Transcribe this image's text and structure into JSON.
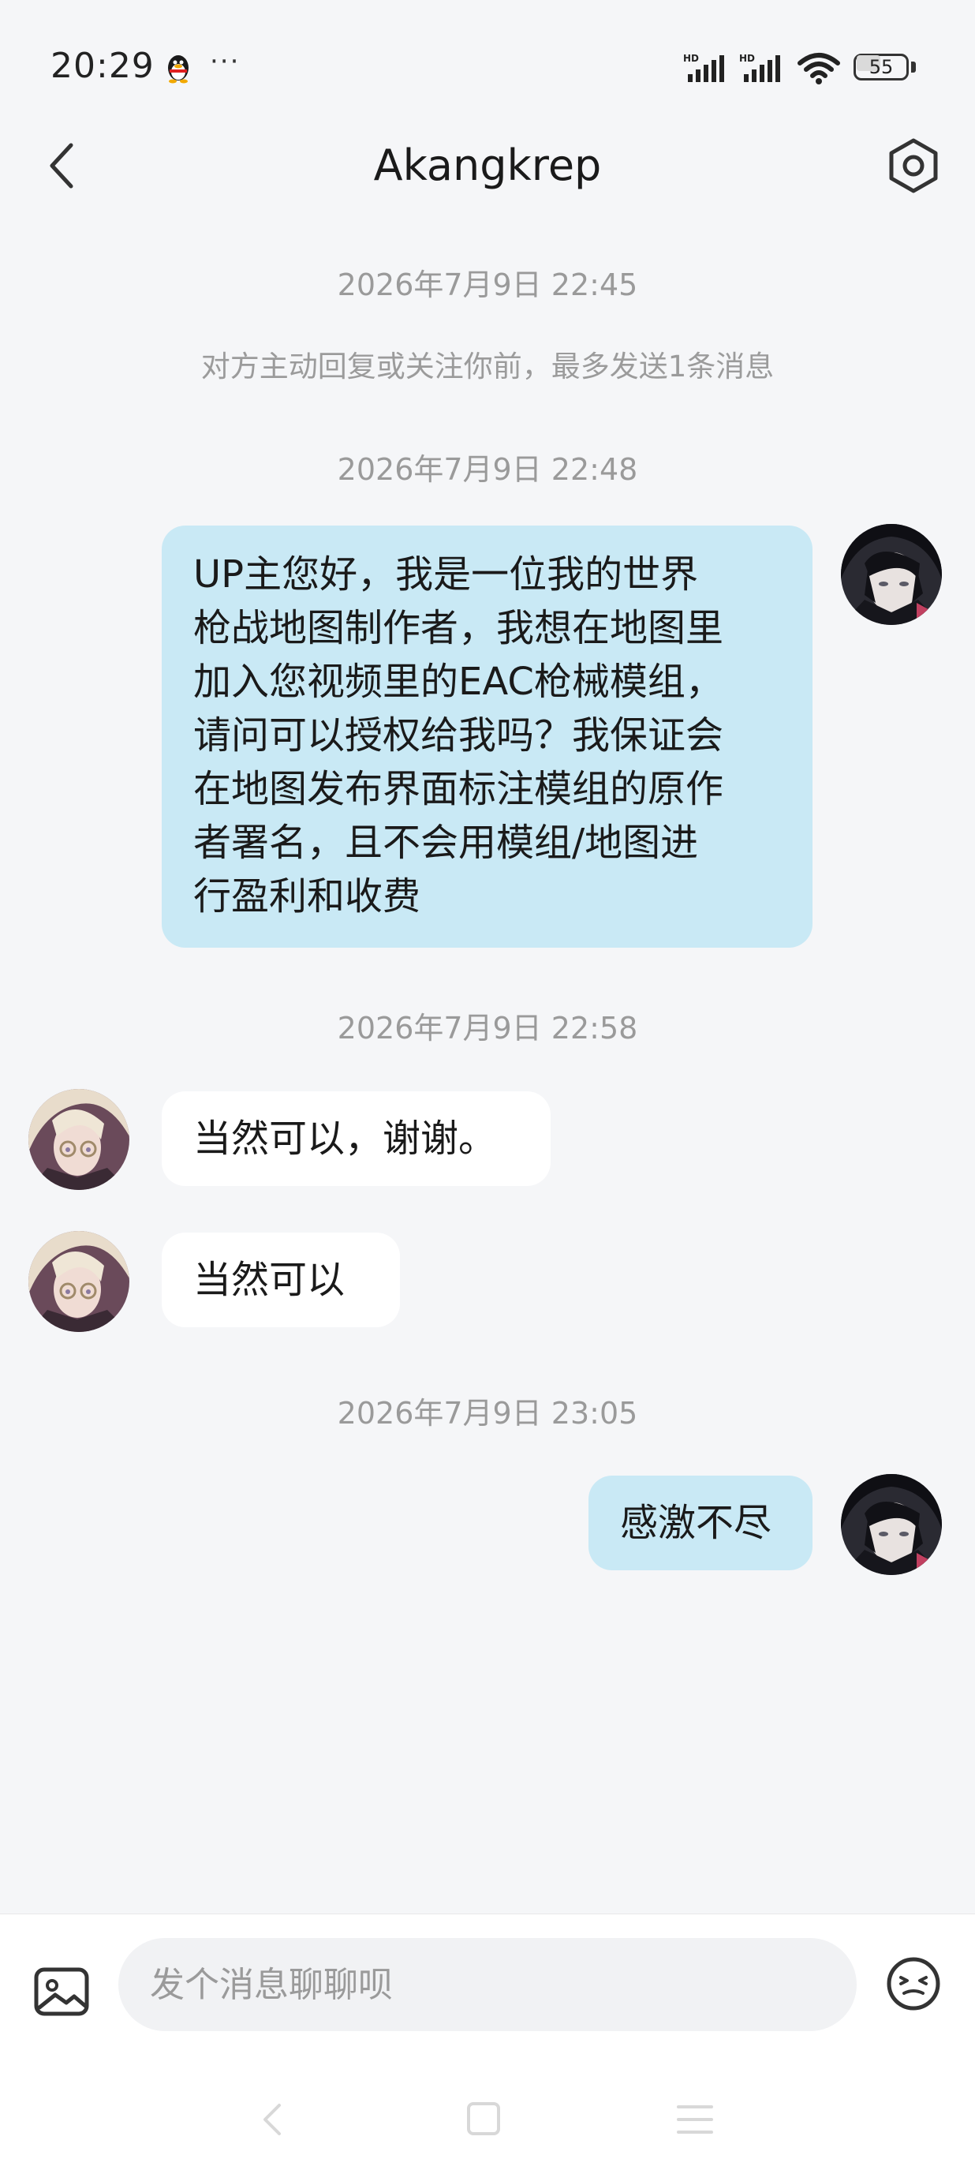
{
  "status_bar": {
    "time": "20:29",
    "battery": "55",
    "icons": [
      "qq-penguin-icon",
      "more-dots-icon",
      "hd-signal-icon",
      "hd-signal-icon",
      "wifi-icon",
      "battery-icon"
    ],
    "more": "···"
  },
  "header": {
    "title": "Akangkrep",
    "back_icon": "chevron-left-icon",
    "settings_icon": "hexagon-settings-icon"
  },
  "chat": {
    "timestamp_1": "2026年7月9日 22:45",
    "notice": "对方主动回复或关注你前，最多发送1条消息",
    "timestamp_2": "2026年7月9日 22:48",
    "msg_1": "UP主您好，我是一位我的世界\n枪战地图制作者，我想在地图里\n加入您视频里的EAC枪械模组，\n请问可以授权给我吗？我保证会\n在地图发布界面标注模组的原作\n者署名，且不会用模组/地图进\n行盈利和收费",
    "timestamp_3": "2026年7月9日 22:58",
    "reply_1": "当然可以，谢谢。",
    "reply_2": "当然可以",
    "timestamp_4": "2026年7月9日 23:05",
    "msg_2": "感激不尽"
  },
  "input_bar": {
    "placeholder": "发个消息聊聊呗",
    "image_icon": "image-icon",
    "emoji_icon": "emoji-icon"
  },
  "colors": {
    "background": "#f5f6f8",
    "outgoing_bubble": "#c9e9f5",
    "incoming_bubble": "#ffffff",
    "meta_text": "#9a9a9a"
  }
}
